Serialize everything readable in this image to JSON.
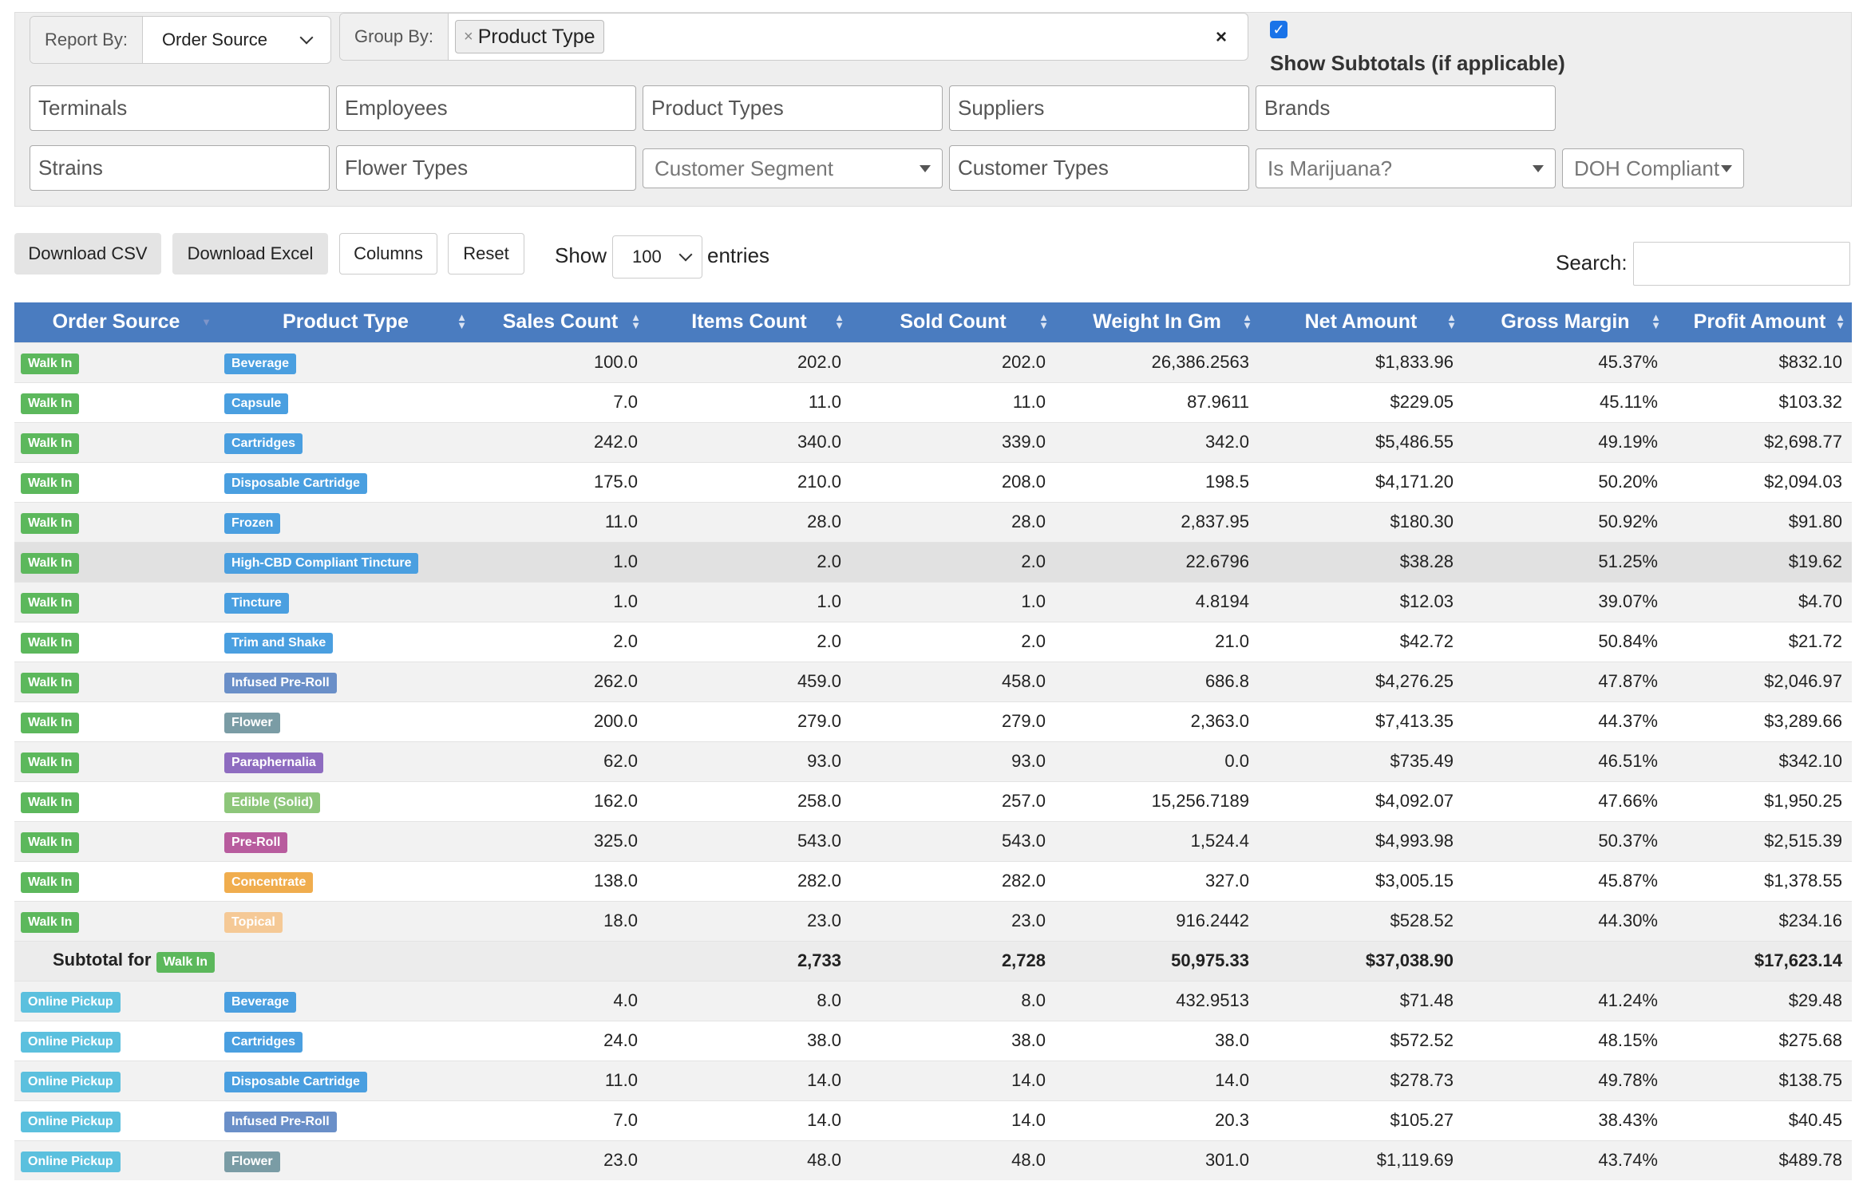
{
  "report_by": {
    "label": "Report By:",
    "value": "Order Source"
  },
  "group_by": {
    "label": "Group By:",
    "tag": "Product Type",
    "tag_x": "×",
    "clear": "×"
  },
  "subtotals": {
    "checkbox": "✓",
    "label": "Show Subtotals (if applicable)"
  },
  "fields_row1": [
    "Terminals",
    "Employees",
    "Product Types",
    "Suppliers",
    "Brands"
  ],
  "fields_row2": {
    "strains": "Strains",
    "flower_types": "Flower Types",
    "customer_segment": "Customer Segment",
    "customer_types": "Customer Types",
    "is_marijuana": "Is Marijuana?",
    "doh": "DOH Compliant"
  },
  "buttons": {
    "csv": "Download CSV",
    "excel": "Download Excel",
    "columns": "Columns",
    "reset": "Reset"
  },
  "length": {
    "show": "Show",
    "value": "100",
    "entries": "entries"
  },
  "search": {
    "label": "Search:",
    "value": ""
  },
  "columns": [
    "Order Source",
    "Product Type",
    "Sales Count",
    "Items Count",
    "Sold Count",
    "Weight In Gm",
    "Net Amount",
    "Gross Margin",
    "Profit Amount"
  ],
  "colors": {
    "header": "#4a7cc0",
    "walk_in": "#5cb85c",
    "online_pickup": "#5bc0de"
  },
  "rows": [
    {
      "source": "Walk In",
      "type": "Beverage",
      "type_color": "#4a9fe0",
      "sales": "100.0",
      "items": "202.0",
      "sold": "202.0",
      "weight": "26,386.2563",
      "net": "$1,833.96",
      "margin": "45.37%",
      "profit": "$832.10"
    },
    {
      "source": "Walk In",
      "type": "Capsule",
      "type_color": "#4a9fe0",
      "sales": "7.0",
      "items": "11.0",
      "sold": "11.0",
      "weight": "87.9611",
      "net": "$229.05",
      "margin": "45.11%",
      "profit": "$103.32"
    },
    {
      "source": "Walk In",
      "type": "Cartridges",
      "type_color": "#4a9fe0",
      "sales": "242.0",
      "items": "340.0",
      "sold": "339.0",
      "weight": "342.0",
      "net": "$5,486.55",
      "margin": "49.19%",
      "profit": "$2,698.77"
    },
    {
      "source": "Walk In",
      "type": "Disposable Cartridge",
      "type_color": "#4a9fe0",
      "sales": "175.0",
      "items": "210.0",
      "sold": "208.0",
      "weight": "198.5",
      "net": "$4,171.20",
      "margin": "50.20%",
      "profit": "$2,094.03"
    },
    {
      "source": "Walk In",
      "type": "Frozen",
      "type_color": "#4a9fe0",
      "sales": "11.0",
      "items": "28.0",
      "sold": "28.0",
      "weight": "2,837.95",
      "net": "$180.30",
      "margin": "50.92%",
      "profit": "$91.80"
    },
    {
      "source": "Walk In",
      "type": "High-CBD Compliant Tincture",
      "type_color": "#4a9fe0",
      "sales": "1.0",
      "items": "2.0",
      "sold": "2.0",
      "weight": "22.6796",
      "net": "$38.28",
      "margin": "51.25%",
      "profit": "$19.62",
      "hl": true
    },
    {
      "source": "Walk In",
      "type": "Tincture",
      "type_color": "#4a9fe0",
      "sales": "1.0",
      "items": "1.0",
      "sold": "1.0",
      "weight": "4.8194",
      "net": "$12.03",
      "margin": "39.07%",
      "profit": "$4.70"
    },
    {
      "source": "Walk In",
      "type": "Trim and Shake",
      "type_color": "#4a9fe0",
      "sales": "2.0",
      "items": "2.0",
      "sold": "2.0",
      "weight": "21.0",
      "net": "$42.72",
      "margin": "50.84%",
      "profit": "$21.72"
    },
    {
      "source": "Walk In",
      "type": "Infused Pre-Roll",
      "type_color": "#6a8fc8",
      "sales": "262.0",
      "items": "459.0",
      "sold": "458.0",
      "weight": "686.8",
      "net": "$4,276.25",
      "margin": "47.87%",
      "profit": "$2,046.97"
    },
    {
      "source": "Walk In",
      "type": "Flower",
      "type_color": "#7a9ca5",
      "sales": "200.0",
      "items": "279.0",
      "sold": "279.0",
      "weight": "2,363.0",
      "net": "$7,413.35",
      "margin": "44.37%",
      "profit": "$3,289.66"
    },
    {
      "source": "Walk In",
      "type": "Paraphernalia",
      "type_color": "#8e6cc0",
      "sales": "62.0",
      "items": "93.0",
      "sold": "93.0",
      "weight": "0.0",
      "net": "$735.49",
      "margin": "46.51%",
      "profit": "$342.10"
    },
    {
      "source": "Walk In",
      "type": "Edible (Solid)",
      "type_color": "#8dc67a",
      "sales": "162.0",
      "items": "258.0",
      "sold": "257.0",
      "weight": "15,256.7189",
      "net": "$4,092.07",
      "margin": "47.66%",
      "profit": "$1,950.25"
    },
    {
      "source": "Walk In",
      "type": "Pre-Roll",
      "type_color": "#b85c9e",
      "sales": "325.0",
      "items": "543.0",
      "sold": "543.0",
      "weight": "1,524.4",
      "net": "$4,993.98",
      "margin": "50.37%",
      "profit": "$2,515.39"
    },
    {
      "source": "Walk In",
      "type": "Concentrate",
      "type_color": "#f0ad4e",
      "sales": "138.0",
      "items": "282.0",
      "sold": "282.0",
      "weight": "327.0",
      "net": "$3,005.15",
      "margin": "45.87%",
      "profit": "$1,378.55"
    },
    {
      "source": "Walk In",
      "type": "Topical",
      "type_color": "#f5c996",
      "sales": "18.0",
      "items": "23.0",
      "sold": "23.0",
      "weight": "916.2442",
      "net": "$528.52",
      "margin": "44.30%",
      "profit": "$234.16"
    }
  ],
  "subtotal": {
    "label": "Subtotal for",
    "source": "Walk In",
    "items": "2,733",
    "sold": "2,728",
    "weight": "50,975.33",
    "net": "$37,038.90",
    "profit": "$17,623.14"
  },
  "rows2": [
    {
      "source": "Online Pickup",
      "type": "Beverage",
      "type_color": "#4a9fe0",
      "sales": "4.0",
      "items": "8.0",
      "sold": "8.0",
      "weight": "432.9513",
      "net": "$71.48",
      "margin": "41.24%",
      "profit": "$29.48"
    },
    {
      "source": "Online Pickup",
      "type": "Cartridges",
      "type_color": "#4a9fe0",
      "sales": "24.0",
      "items": "38.0",
      "sold": "38.0",
      "weight": "38.0",
      "net": "$572.52",
      "margin": "48.15%",
      "profit": "$275.68"
    },
    {
      "source": "Online Pickup",
      "type": "Disposable Cartridge",
      "type_color": "#4a9fe0",
      "sales": "11.0",
      "items": "14.0",
      "sold": "14.0",
      "weight": "14.0",
      "net": "$278.73",
      "margin": "49.78%",
      "profit": "$138.75"
    },
    {
      "source": "Online Pickup",
      "type": "Infused Pre-Roll",
      "type_color": "#6a8fc8",
      "sales": "7.0",
      "items": "14.0",
      "sold": "14.0",
      "weight": "20.3",
      "net": "$105.27",
      "margin": "38.43%",
      "profit": "$40.45"
    },
    {
      "source": "Online Pickup",
      "type": "Flower",
      "type_color": "#7a9ca5",
      "sales": "23.0",
      "items": "48.0",
      "sold": "48.0",
      "weight": "301.0",
      "net": "$1,119.69",
      "margin": "43.74%",
      "profit": "$489.78"
    }
  ]
}
